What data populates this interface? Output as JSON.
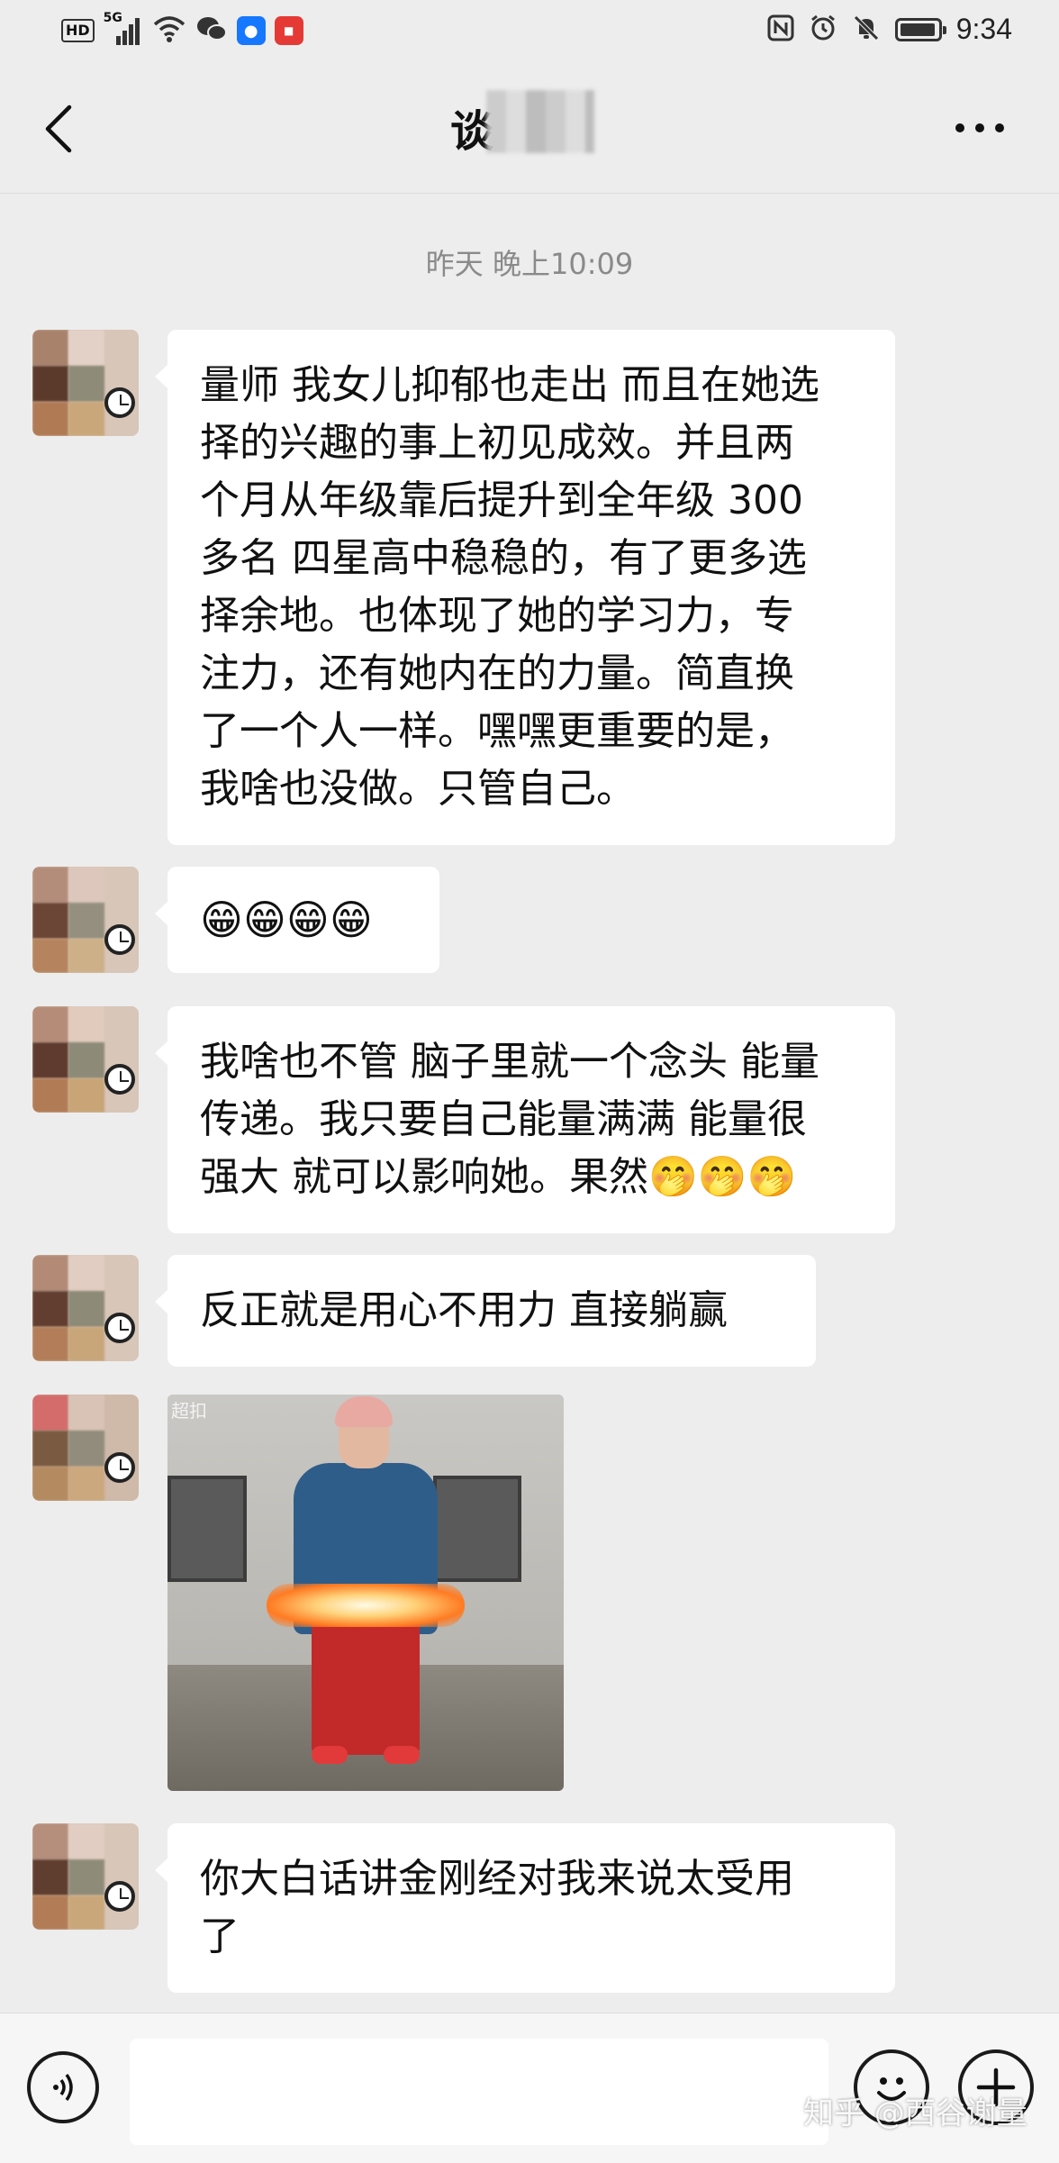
{
  "status_bar": {
    "network_badge": "HD",
    "signal_label": "5G",
    "time": "9:34",
    "battery_level": 0.95,
    "icons": [
      "hd-icon",
      "signal-icon",
      "wifi-icon",
      "wechat-icon",
      "bulb-app-icon",
      "red-app-icon",
      "nfc-icon",
      "alarm-icon",
      "mute-icon",
      "battery-icon"
    ]
  },
  "header": {
    "title_visible_char": "谈",
    "back_icon": "chevron-left-icon",
    "more_icon": "more-dots-icon"
  },
  "conversation": {
    "timestamp": "昨天 晚上10:09",
    "messages": [
      {
        "type": "text",
        "text": "量师 我女儿抑郁也走出 而且在她选\n择的兴趣的事上初见成效。并且两\n个月从年级靠后提升到全年级 300\n多名 四星高中稳稳的，有了更多选\n择余地。也体现了她的学习力，专\n注力，还有她内在的力量。简直换\n了一个人一样。嘿嘿更重要的是，\n我啥也没做。只管自己。"
      },
      {
        "type": "text",
        "text": "😁😁😁😁"
      },
      {
        "type": "text",
        "text": "我啥也不管 脑子里就一个念头 能量\n传递。我只要自己能量满满 能量很\n强大 就可以影响她。果然🤭🤭🤭"
      },
      {
        "type": "text",
        "text": "反正就是用心不用力 直接躺赢"
      },
      {
        "type": "image",
        "caption": "",
        "watermark": "超扣"
      },
      {
        "type": "text",
        "text": "你大白话讲金刚经对我来说太受用\n了"
      }
    ]
  },
  "input_bar": {
    "voice_icon": "voice-icon",
    "emoji_icon": "emoji-icon",
    "plus_icon": "plus-icon",
    "text_value": ""
  },
  "watermark": "知乎 @西谷谢量"
}
